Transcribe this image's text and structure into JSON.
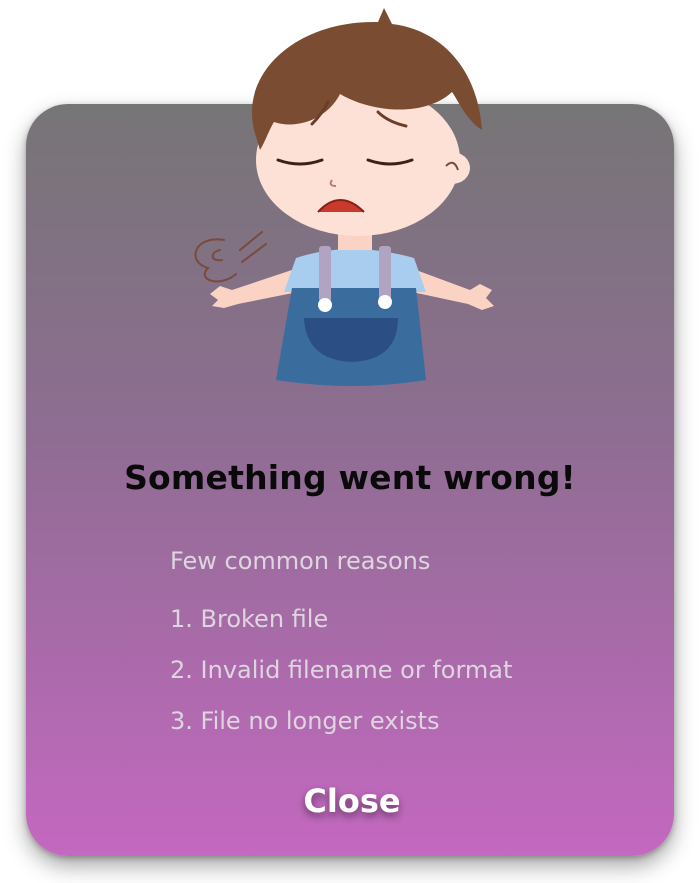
{
  "dialog": {
    "title": "Something went wrong!",
    "reasons_heading": "Few common reasons",
    "reasons": [
      "1. Broken file",
      "2. Invalid filename or format",
      "3. File no longer exists"
    ],
    "close_label": "Close"
  },
  "colors": {
    "card_top": "#767576",
    "card_bottom": "#c468c0",
    "title": "#0a0a0a",
    "reason_text": "#ded6df",
    "button_text": "#ffffff"
  },
  "icons": {
    "illustration": "sad-boy-illustration"
  }
}
